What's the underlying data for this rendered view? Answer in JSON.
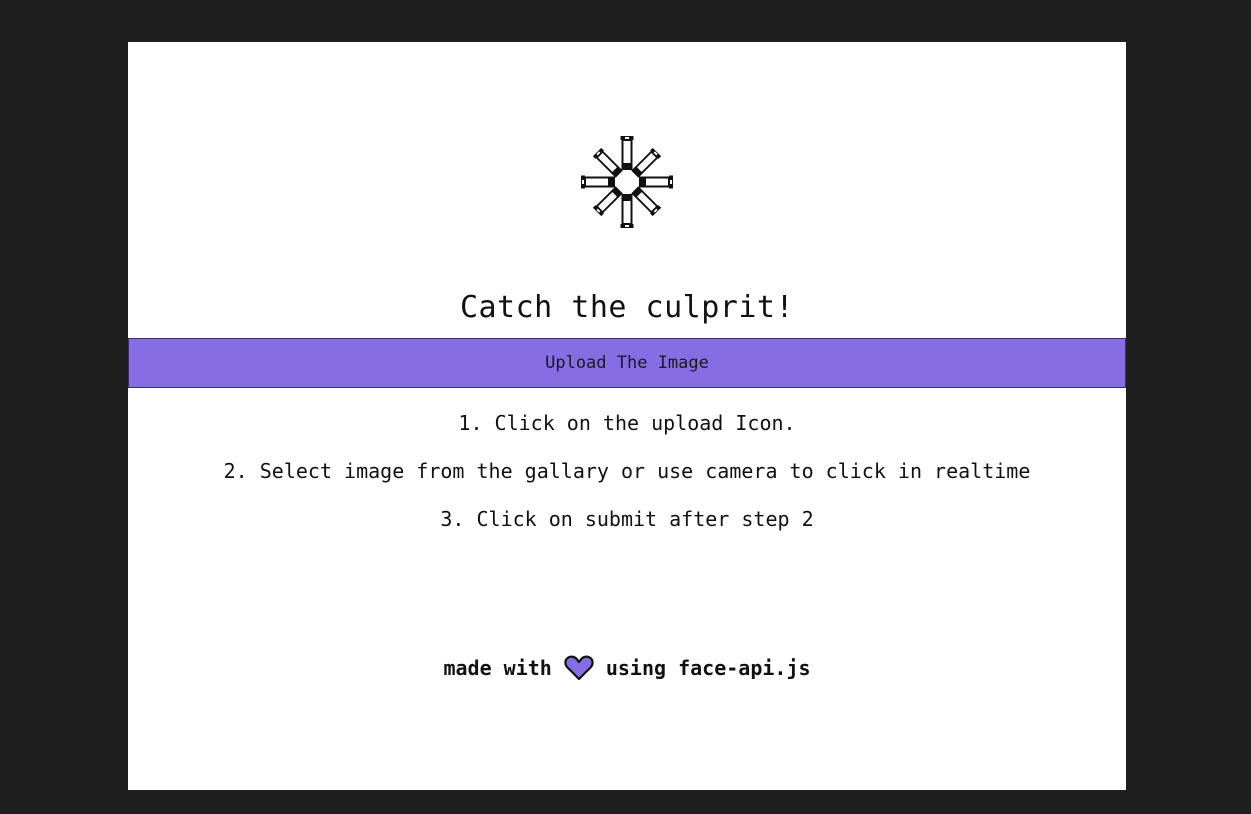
{
  "theme": {
    "page_background": "#1f1f1f",
    "card_background": "#ffffff",
    "accent": "#876de4"
  },
  "header": {
    "logo_icon": "bullets-ring-icon",
    "title": "Catch the culprit!"
  },
  "upload": {
    "label": "Upload The Image"
  },
  "steps": [
    "1. Click on the upload Icon.",
    "2. Select image from the gallary or use camera to click in realtime",
    "3. Click on submit after step 2"
  ],
  "footer": {
    "prefix": "made with",
    "icon": "heart-icon",
    "suffix": "using face-api.js"
  }
}
